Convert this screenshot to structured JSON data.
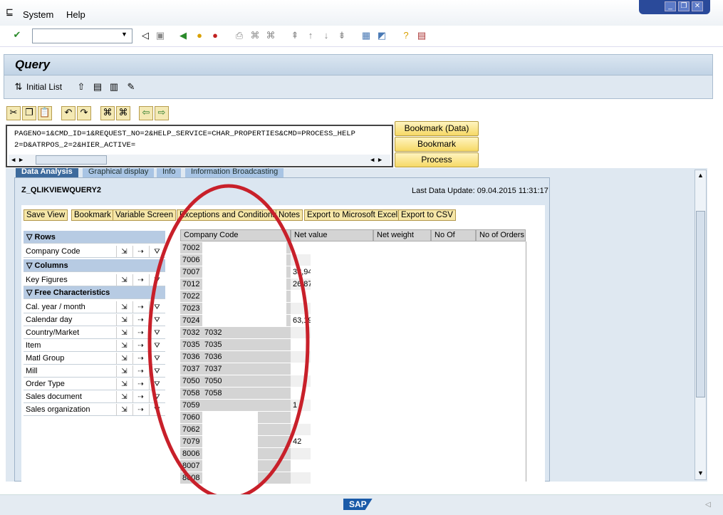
{
  "menu": {
    "items": [
      "System",
      "Help"
    ]
  },
  "toolbar": {
    "command_placeholder": "",
    "icons": [
      "enter-icon",
      "back-icon",
      "save-icon",
      "back-green-icon",
      "exit-icon",
      "cancel-icon",
      "print-icon",
      "find-icon",
      "find-next-icon",
      "first-page-icon",
      "prev-page-icon",
      "next-page-icon",
      "last-page-icon",
      "new-session-icon",
      "shortcut-icon",
      "help-icon",
      "layout-icon"
    ]
  },
  "title": "Query",
  "app_toolbar": {
    "initial_list": "Initial List"
  },
  "url_text": {
    "line1": "PAGENO=1&CMD_ID=1&REQUEST_NO=2&HELP_SERVICE=CHAR_PROPERTIES&CMD=PROCESS_HELP",
    "line2": "2=D&ATRPOS_2=2&HIER_ACTIVE="
  },
  "side_buttons": [
    "Bookmark (Data)",
    "Bookmark",
    "Process"
  ],
  "tabs": [
    "Data Analysis",
    "Graphical display",
    "Info",
    "Information Broadcasting"
  ],
  "query": {
    "name": "Z_QLIKVIEWQUERY2",
    "last_update": "Last Data Update: 09.04.2015 11:31:17"
  },
  "bex_buttons": [
    "Save View",
    "Bookmark",
    "Variable Screen",
    "Exceptions and Conditions",
    "Notes",
    "Export to Microsoft Excel",
    "Export to CSV"
  ],
  "nav": {
    "rows_label": "Rows",
    "rows": [
      "Company Code"
    ],
    "columns_label": "Columns",
    "columns": [
      "Key Figures"
    ],
    "free_label": "Free Characteristics",
    "free": [
      "Cal. year / month",
      "Calendar day",
      "Country/Market",
      "Item",
      "Matl Group",
      "Mill",
      "Order Type",
      "Sales document",
      "Sales organization"
    ]
  },
  "table": {
    "headers": [
      "Company Code",
      "Net value",
      "Net weight Item",
      "No Of Items",
      "No of Orders"
    ],
    "rows": [
      [
        "7002",
        "",
        ""
      ],
      [
        "7006",
        "",
        ""
      ],
      [
        "7007",
        "",
        "38,94"
      ],
      [
        "7012",
        "",
        "26,87"
      ],
      [
        "7022",
        "",
        ""
      ],
      [
        "7023",
        "",
        ""
      ],
      [
        "7024",
        "",
        "63,19"
      ],
      [
        "7032",
        "7032",
        ""
      ],
      [
        "7035",
        "7035",
        ""
      ],
      [
        "7036",
        "7036",
        ""
      ],
      [
        "7037",
        "7037",
        ""
      ],
      [
        "7050",
        "7050",
        ""
      ],
      [
        "7058",
        "7058",
        ""
      ],
      [
        "7059",
        "",
        "1"
      ],
      [
        "7060",
        "",
        ""
      ],
      [
        "7062",
        "",
        ""
      ],
      [
        "7079",
        "",
        "42"
      ],
      [
        "8006",
        "",
        ""
      ],
      [
        "8007",
        "",
        ""
      ],
      [
        "8008",
        "",
        ""
      ]
    ]
  },
  "colors": {
    "annotation": "#c8202a",
    "header_bg": "#c1d3e5",
    "button_bg": "#f6d966"
  }
}
